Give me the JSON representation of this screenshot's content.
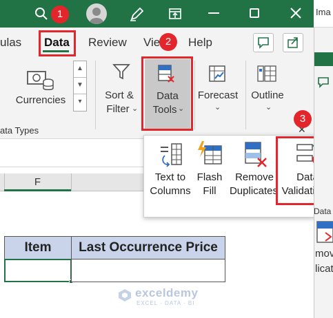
{
  "titlebar": {
    "window_controls": [
      "minimize",
      "restore",
      "close"
    ]
  },
  "tabs": [
    {
      "label": "ulas"
    },
    {
      "label": "Data",
      "active": true
    },
    {
      "label": "Review"
    },
    {
      "label": "Vie"
    },
    {
      "label": "Help"
    }
  ],
  "ribbon": {
    "currencies": "Currencies",
    "data_types_group": "ata Types",
    "sort_filter": [
      "Sort &",
      "Filter"
    ],
    "data_tools": [
      "Data",
      "Tools"
    ],
    "forecast": "Forecast",
    "outline": "Outline"
  },
  "data_tools_panel": {
    "text_to_columns": [
      "Text to",
      "Columns"
    ],
    "flash_fill": [
      "Flash",
      "Fill"
    ],
    "remove_duplicates": [
      "Remove",
      "Duplicates"
    ],
    "data_validation": [
      "Data",
      "Validation"
    ],
    "group_label": "Data"
  },
  "sheet": {
    "column_header": "F",
    "table_headers": [
      "Item",
      "Last Occurrence Price"
    ]
  },
  "annotations": {
    "step1": "1",
    "step2": "2",
    "step3": "3"
  },
  "right_window": {
    "title_fragment": "Ima",
    "label_fragment_1": "mov",
    "label_fragment_2": "licat"
  },
  "watermark": {
    "brand": "exceldemy",
    "tagline": "EXCEL · DATA · BI"
  },
  "colors": {
    "excel_green": "#217346",
    "annotation_red": "#e3262b",
    "table_header_fill": "#c9d4ea"
  }
}
